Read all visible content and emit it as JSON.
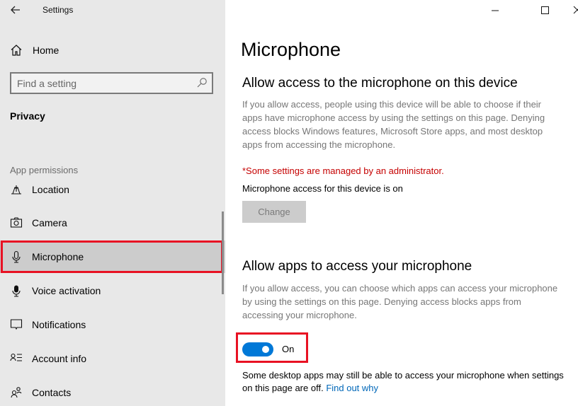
{
  "window": {
    "title": "Settings",
    "controls": {
      "minimize": "minimize",
      "maximize": "maximize",
      "close": "close"
    }
  },
  "sidebar": {
    "home_label": "Home",
    "search_placeholder": "Find a setting",
    "section_title": "Privacy",
    "group_label": "App permissions",
    "items": [
      {
        "label": "Location",
        "icon": "location-icon",
        "selected": false
      },
      {
        "label": "Camera",
        "icon": "camera-icon",
        "selected": false
      },
      {
        "label": "Microphone",
        "icon": "microphone-icon",
        "selected": true
      },
      {
        "label": "Voice activation",
        "icon": "voice-activation-icon",
        "selected": false
      },
      {
        "label": "Notifications",
        "icon": "notifications-icon",
        "selected": false
      },
      {
        "label": "Account info",
        "icon": "account-info-icon",
        "selected": false
      },
      {
        "label": "Contacts",
        "icon": "contacts-icon",
        "selected": false
      }
    ]
  },
  "main": {
    "page_title": "Microphone",
    "device_section": {
      "heading": "Allow access to the microphone on this device",
      "description": "If you allow access, people using this device will be able to choose if their apps have microphone access by using the settings on this page. Denying access blocks Windows features, Microsoft Store apps, and most desktop apps from accessing the microphone.",
      "admin_warning": "*Some settings are managed by an administrator.",
      "status": "Microphone access for this device is on",
      "change_button": "Change"
    },
    "apps_section": {
      "heading": "Allow apps to access your microphone",
      "description": "If you allow access, you can choose which apps can access your microphone by using the settings on this page. Denying access blocks apps from accessing your microphone.",
      "toggle_state": "On",
      "toggle_on": true,
      "footnote": "Some desktop apps may still be able to access your microphone when settings on this page are off.",
      "link": "Find out why"
    }
  },
  "colors": {
    "accent": "#0078d7",
    "highlight": "#e81123",
    "warning": "#c50000",
    "link": "#0067b8"
  }
}
